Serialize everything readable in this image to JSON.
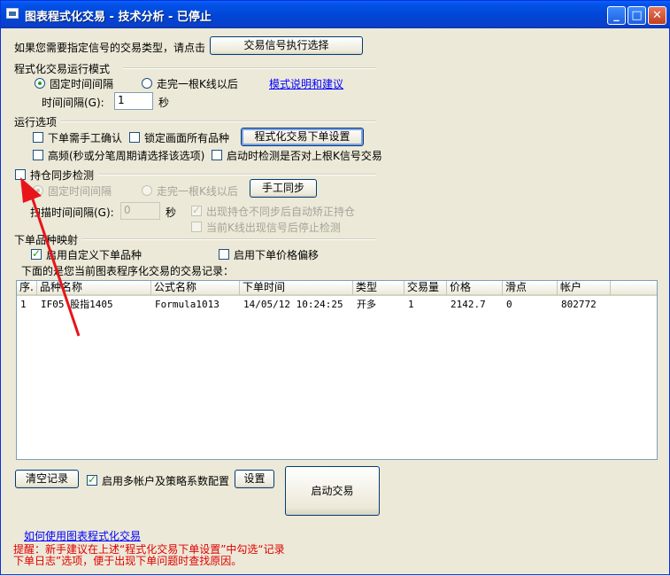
{
  "window": {
    "title": "图表程式化交易 - 技术分析 - 已停止",
    "controls": {
      "minimize": "_",
      "maximize": "□",
      "close": "✕"
    }
  },
  "signal": {
    "prompt": "如果您需要指定信号的交易类型，请点击",
    "button_label": "交易信号执行选择"
  },
  "run_mode": {
    "group_title": "程式化交易运行模式",
    "radio_fixed": "固定时间间隔",
    "radio_kline": "走完一根K线以后",
    "help_link": "模式说明和建议",
    "interval_label": "时间间隔(G):",
    "interval_value": "1",
    "interval_unit": "秒"
  },
  "run_options": {
    "group_title": "运行选项",
    "manual_confirm": "下单需手工确认",
    "lock_all": "锁定画面所有品种",
    "order_settings_button": "程式化交易下单设置",
    "high_freq": "高频(秒或分笔周期请选择该选项)",
    "startup_check": "启动时检测是否对上根K信号交易"
  },
  "position_sync": {
    "title": "持仓同步检测",
    "radio_fixed": "固定时间间隔",
    "radio_kline": "走完一根K线以后",
    "manual_sync_button": "手工同步",
    "scan_label": "扫描时间间隔(G):",
    "scan_value": "0",
    "scan_unit": "秒",
    "auto_fix": "出现持仓不同步后自动矫正持仓",
    "stop_detect": "当前K线出现信号后停止检测"
  },
  "order_mapping": {
    "group_title": "下单品种映射",
    "custom_variety": "启用自定义下单品种",
    "price_offset": "启用下单价格偏移"
  },
  "records": {
    "caption": "下面的是您当前图表程序化交易的交易记录：",
    "columns": [
      "序.",
      "品种名称",
      "公式名称",
      "下单时间",
      "类型",
      "交易量",
      "价格",
      "滑点",
      "帐户"
    ],
    "rows": [
      [
        "1",
        "IF05 股指1405",
        "Formula1013",
        "14/05/12 10:24:25",
        "开多",
        "1",
        "2142.7",
        "0",
        "802772"
      ]
    ]
  },
  "footer": {
    "clear_button": "清空记录",
    "multi_account": "启用多帐户及策略系数配置",
    "settings_button": "设置",
    "start_button": "启动交易",
    "howto_link": "如何使用图表程式化交易",
    "warning_line1": "提醒：新手建议在上述“程式化交易下单设置”中勾选“记录",
    "warning_line2": "下单日志”选项，便于出现下单问题时查找原因。"
  },
  "colors": {
    "titlebar": "#0046d6",
    "annotation_arrow": "#e8141a",
    "warning_text": "#e00000",
    "link": "#0000ff"
  }
}
